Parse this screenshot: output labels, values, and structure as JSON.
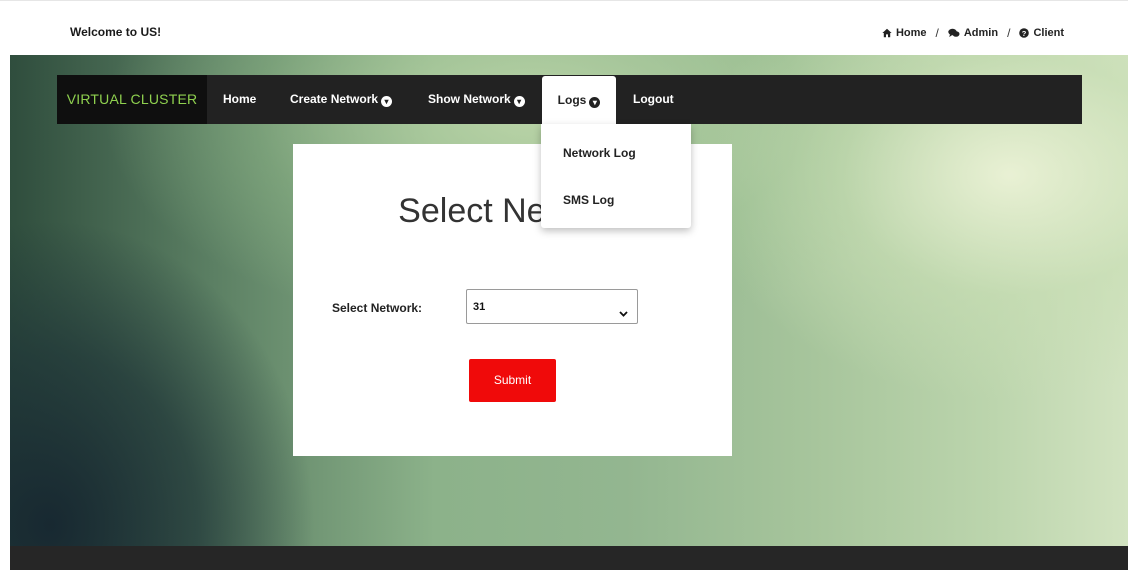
{
  "topbar": {
    "welcome": "Welcome to US!",
    "links": [
      {
        "label": "Home",
        "icon": "home-icon"
      },
      {
        "label": "Admin",
        "icon": "chat-icon"
      },
      {
        "label": "Client",
        "icon": "question-circle-icon"
      }
    ],
    "separator": "/"
  },
  "navbar": {
    "brand": "VIRTUAL CLUSTER",
    "items": [
      {
        "label": "Home"
      },
      {
        "label": "Create Network",
        "icon": "chevron-circle-down-icon"
      },
      {
        "label": "Show Network",
        "icon": "chevron-circle-down-icon"
      },
      {
        "label": "Logs",
        "icon": "chevron-circle-down-icon",
        "active": true
      },
      {
        "label": "Logout"
      }
    ]
  },
  "dropdown": {
    "items": [
      {
        "label": "Network Log"
      },
      {
        "label": "SMS Log"
      }
    ]
  },
  "form": {
    "title": "Select Network",
    "field_label": "Select Network:",
    "selected_value": "31",
    "submit_label": "Submit"
  },
  "colors": {
    "navbar": "#222222",
    "brand_text": "#8fd14f",
    "submit": "#f00a0a",
    "footer": "#262626"
  }
}
